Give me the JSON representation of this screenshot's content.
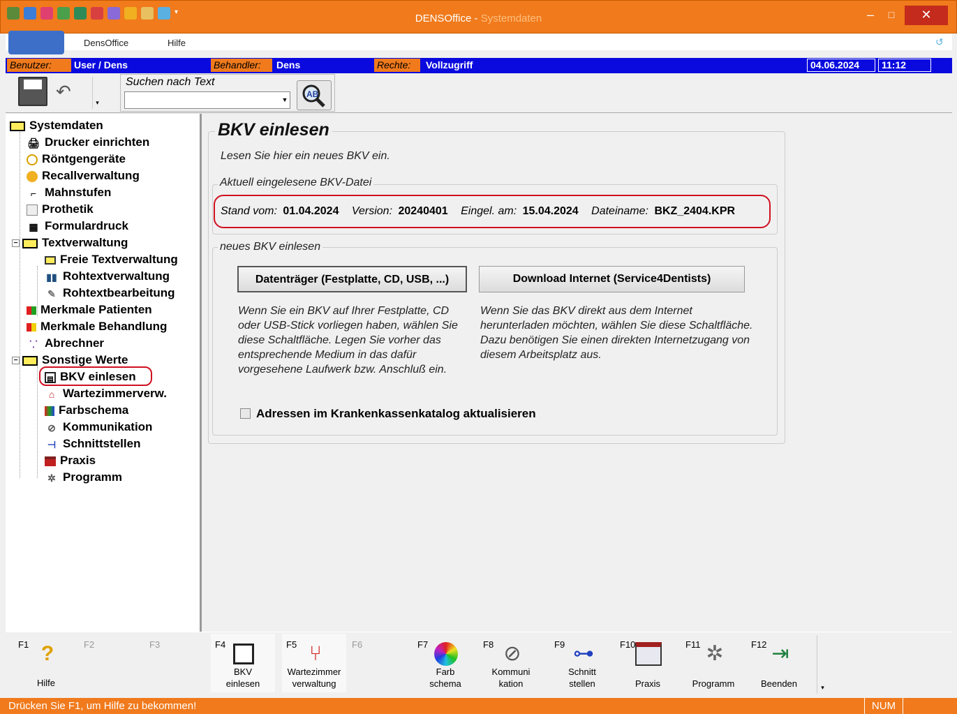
{
  "window": {
    "title": "DENSOffice - ",
    "title_sub": "Systemdaten",
    "minimize": "–",
    "maximize": "□",
    "close": "✕"
  },
  "menu": {
    "items": [
      "DensOffice",
      "Hilfe"
    ]
  },
  "infobar": {
    "user_label": "Benutzer:",
    "user_value": "User / Dens",
    "doctor_label": "Behandler:",
    "doctor_value": "Dens",
    "rights_label": "Rechte:",
    "rights_value": "Vollzugriff",
    "date": "04.06.2024",
    "time": "11:12"
  },
  "search": {
    "label": "Suchen nach Text",
    "value": ""
  },
  "tree": {
    "root": "Systemdaten",
    "items": [
      {
        "label": "Drucker einrichten",
        "icon": "printer-icon",
        "level": 1
      },
      {
        "label": "Röntgengeräte",
        "icon": "xray-icon",
        "level": 1
      },
      {
        "label": "Recallverwaltung",
        "icon": "recall-icon",
        "level": 1
      },
      {
        "label": "Mahnstufen",
        "icon": "stairs-icon",
        "level": 1
      },
      {
        "label": "Prothetik",
        "icon": "prothetik-icon",
        "level": 1
      },
      {
        "label": "Formulardruck",
        "icon": "form-print-icon",
        "level": 1
      },
      {
        "label": "Textverwaltung",
        "icon": "folder-icon",
        "level": 1,
        "folder": true
      },
      {
        "label": "Freie Textverwaltung",
        "icon": "open-folder-icon",
        "level": 2
      },
      {
        "label": "Rohtextverwaltung",
        "icon": "rohtext-icon",
        "level": 2
      },
      {
        "label": "Rohtextbearbeitung",
        "icon": "edit-icon",
        "level": 2
      },
      {
        "label": "Merkmale Patienten",
        "icon": "blocks-icon",
        "level": 1
      },
      {
        "label": "Merkmale Behandlung",
        "icon": "blocks-icon",
        "level": 1
      },
      {
        "label": "Abrechner",
        "icon": "abrechner-icon",
        "level": 1
      },
      {
        "label": "Sonstige Werte",
        "icon": "folder-icon",
        "level": 1,
        "folder": true
      },
      {
        "label": "BKV einlesen",
        "icon": "book-icon",
        "level": 2
      },
      {
        "label": "Wartezimmerverw.",
        "icon": "waiting-room-icon",
        "level": 2
      },
      {
        "label": "Farbschema",
        "icon": "color-icon",
        "level": 2
      },
      {
        "label": "Kommunikation",
        "icon": "satellite-icon",
        "level": 2
      },
      {
        "label": "Schnittstellen",
        "icon": "plug-icon",
        "level": 2
      },
      {
        "label": "Praxis",
        "icon": "building-icon",
        "level": 2
      },
      {
        "label": "Programm",
        "icon": "program-icon",
        "level": 2
      }
    ]
  },
  "content": {
    "title": "BKV einlesen",
    "intro": "Lesen Sie hier ein neues BKV ein.",
    "current_frame_title": "Aktuell eingelesene BKV-Datei",
    "stand_label": "Stand vom:",
    "stand_value": "01.04.2024",
    "version_label": "Version:",
    "version_value": "20240401",
    "eingel_label": "Eingel. am:",
    "eingel_value": "15.04.2024",
    "file_label": "Dateiname:",
    "file_value": "BKZ_2404.KPR",
    "new_frame_title": "neues BKV einlesen",
    "btn_disk": "Datenträger (Festplatte, CD, USB, ...)",
    "btn_internet": "Download Internet (Service4Dentists)",
    "desc_disk": "Wenn Sie ein BKV auf Ihrer Festplatte, CD oder USB-Stick vorliegen haben, wählen Sie diese Schaltfläche. Legen Sie vorher das entsprechende Medium in das dafür vorgesehene Laufwerk bzw. Anschluß ein.",
    "desc_internet": "Wenn Sie das BKV direkt aus dem Internet herunterladen möchten, wählen Sie diese Schaltfläche. Dazu benötigen Sie einen direkten Internetzugang von diesem Arbeitsplatz aus.",
    "checkbox_label": "Adressen im Krankenkassenkatalog aktualisieren"
  },
  "fkeys": [
    {
      "key": "F1",
      "line1": "",
      "line2": "Hilfe",
      "enabled": true
    },
    {
      "key": "F2",
      "line1": "",
      "line2": "",
      "enabled": false
    },
    {
      "key": "F3",
      "line1": "",
      "line2": "",
      "enabled": false
    },
    {
      "key": "F4",
      "line1": "BKV",
      "line2": "einlesen",
      "enabled": true
    },
    {
      "key": "F5",
      "line1": "Wartezimmer",
      "line2": "verwaltung",
      "enabled": true
    },
    {
      "key": "F6",
      "line1": "",
      "line2": "",
      "enabled": false
    },
    {
      "key": "F7",
      "line1": "Farb",
      "line2": "schema",
      "enabled": true
    },
    {
      "key": "F8",
      "line1": "Kommuni",
      "line2": "kation",
      "enabled": true
    },
    {
      "key": "F9",
      "line1": "Schnitt",
      "line2": "stellen",
      "enabled": true
    },
    {
      "key": "F10",
      "line1": "",
      "line2": "Praxis",
      "enabled": true
    },
    {
      "key": "F11",
      "line1": "",
      "line2": "Programm",
      "enabled": true
    },
    {
      "key": "F12",
      "line1": "",
      "line2": "Beenden",
      "enabled": true
    }
  ],
  "status": {
    "message": "Drücken Sie F1, um Hilfe zu bekommen!",
    "num": "NUM"
  }
}
